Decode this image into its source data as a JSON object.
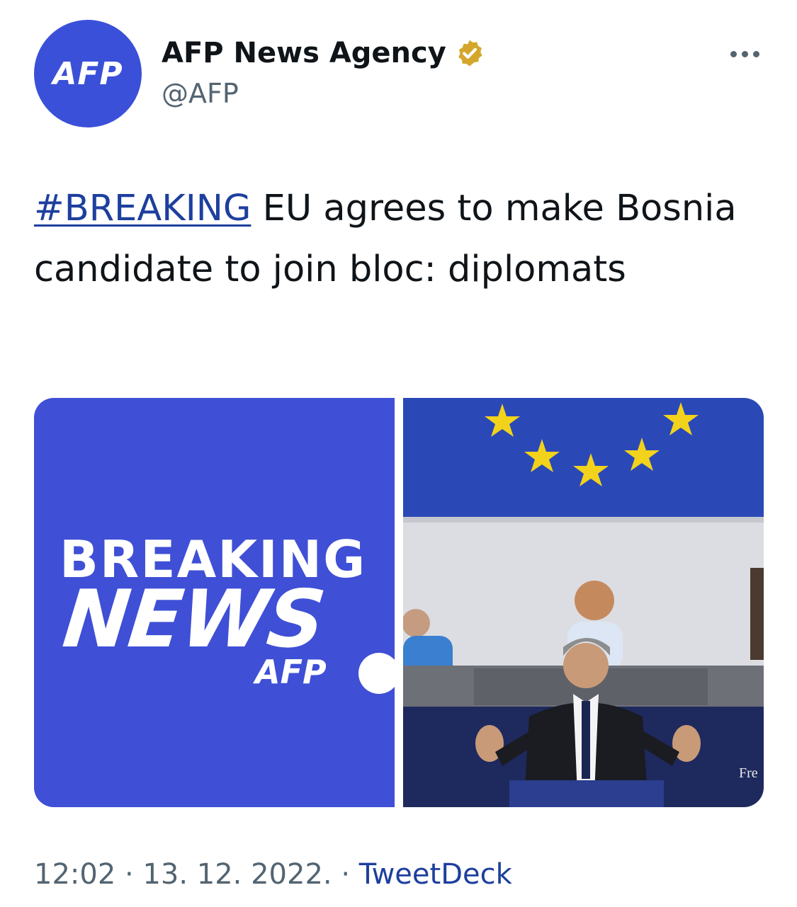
{
  "author": {
    "avatar_text": "AFP",
    "name": "AFP News Agency",
    "handle": "@AFP"
  },
  "tweet": {
    "hashtag": "#BREAKING",
    "text": " EU agrees to make Bosnia candidate to join bloc: diplomats"
  },
  "media": {
    "left": {
      "line1": "BREAKING",
      "line2": "NEWS",
      "logo": "AFP"
    },
    "right": {
      "caption_fragment": "Fre"
    }
  },
  "meta": {
    "time": "12:02",
    "date": "13. 12. 2022.",
    "source": "TweetDeck",
    "separator": " · "
  },
  "colors": {
    "accent": "#1d3f9e",
    "avatar_bg": "#3a50d8",
    "verified": "#d4a72c",
    "muted": "#536471"
  }
}
